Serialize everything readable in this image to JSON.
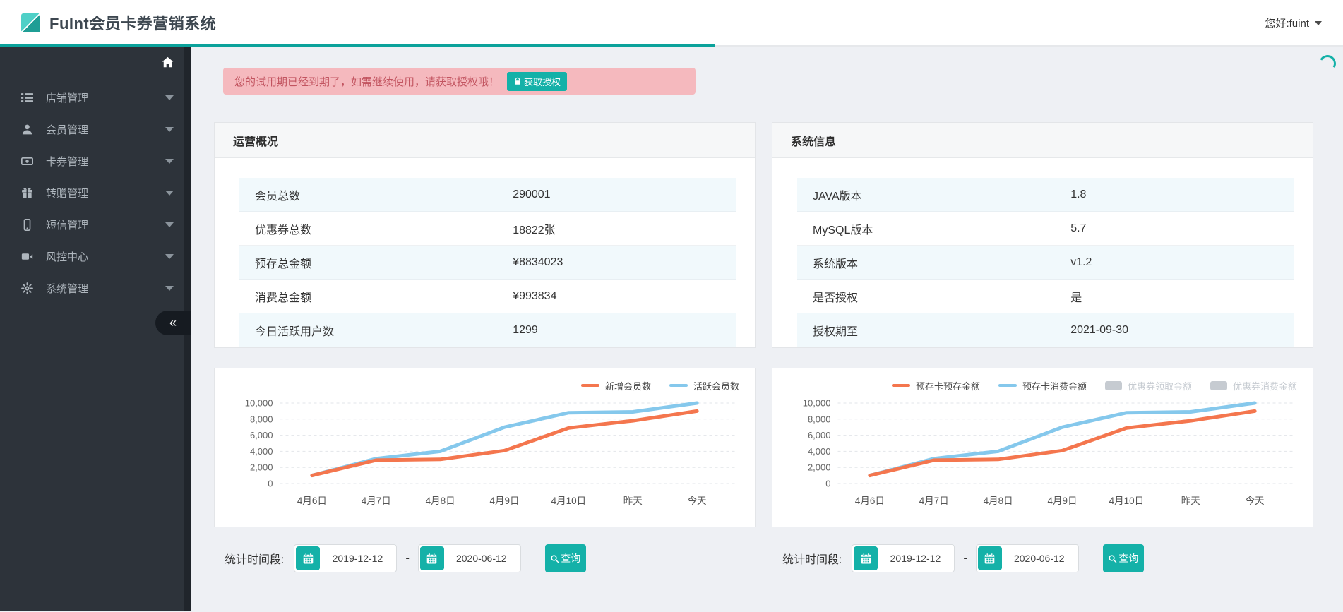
{
  "header": {
    "logo_title": "FuInt会员卡券营销系统",
    "user_greeting": "您好:fuint"
  },
  "sidebar": {
    "collapse_glyph": "«",
    "items": [
      {
        "label": "店铺管理",
        "icon": "list-icon"
      },
      {
        "label": "会员管理",
        "icon": "user-icon"
      },
      {
        "label": "卡券管理",
        "icon": "money-icon"
      },
      {
        "label": "转赠管理",
        "icon": "gift-icon"
      },
      {
        "label": "短信管理",
        "icon": "mobile-icon"
      },
      {
        "label": "风控中心",
        "icon": "video-icon"
      },
      {
        "label": "系统管理",
        "icon": "gear-icon"
      }
    ]
  },
  "alert": {
    "text": "您的试用期已经到期了，如需继续使用，请获取授权哦！",
    "button_label": "获取授权",
    "button_icon": "lock-icon"
  },
  "overview_card": {
    "title": "运营概况",
    "rows": [
      {
        "label": "会员总数",
        "value": "290001"
      },
      {
        "label": "优惠券总数",
        "value": "18822张"
      },
      {
        "label": "预存总金额",
        "value": "¥8834023"
      },
      {
        "label": "消费总金额",
        "value": "¥993834"
      },
      {
        "label": "今日活跃用户数",
        "value": "1299"
      }
    ]
  },
  "system_card": {
    "title": "系统信息",
    "rows": [
      {
        "label": "JAVA版本",
        "value": "1.8"
      },
      {
        "label": "MySQL版本",
        "value": "5.7"
      },
      {
        "label": "系统版本",
        "value": "v1.2"
      },
      {
        "label": "是否授权",
        "value": "是"
      },
      {
        "label": "授权期至",
        "value": "2021-09-30"
      }
    ]
  },
  "chart_data": [
    {
      "type": "line",
      "title": "",
      "categories": [
        "4月6日",
        "4月7日",
        "4月8日",
        "4月9日",
        "4月10日",
        "昨天",
        "今天"
      ],
      "series": [
        {
          "name": "新增会员数",
          "color": "#f4764e",
          "swatch": "line",
          "disabled": false,
          "values": [
            1000,
            2900,
            3000,
            4100,
            6900,
            7800,
            9000
          ]
        },
        {
          "name": "活跃会员数",
          "color": "#85c8ec",
          "swatch": "line",
          "disabled": false,
          "values": [
            1000,
            3100,
            4000,
            7000,
            8800,
            8900,
            10000
          ]
        }
      ],
      "ylim": [
        0,
        10000
      ],
      "yticks": [
        "10,000",
        "8,000",
        "6,000",
        "4,000",
        "2,000",
        "0"
      ],
      "grid": "dashed-horizontal",
      "legend_position": "top-right"
    },
    {
      "type": "line",
      "title": "",
      "categories": [
        "4月6日",
        "4月7日",
        "4月8日",
        "4月9日",
        "4月10日",
        "昨天",
        "今天"
      ],
      "series": [
        {
          "name": "预存卡预存金额",
          "color": "#f4764e",
          "swatch": "line",
          "disabled": false,
          "values": [
            1000,
            2900,
            3000,
            4100,
            6900,
            7800,
            9000
          ]
        },
        {
          "name": "预存卡消费金额",
          "color": "#85c8ec",
          "swatch": "line",
          "disabled": false,
          "values": [
            1000,
            3100,
            4000,
            7000,
            8800,
            8900,
            10000
          ]
        },
        {
          "name": "优惠券领取金额",
          "color": "#c6cbd1",
          "swatch": "rect",
          "disabled": true,
          "values": []
        },
        {
          "name": "优惠券消费金额",
          "color": "#c6cbd1",
          "swatch": "rect",
          "disabled": true,
          "values": []
        }
      ],
      "ylim": [
        0,
        10000
      ],
      "yticks": [
        "10,000",
        "8,000",
        "6,000",
        "4,000",
        "2,000",
        "0"
      ],
      "grid": "dashed-horizontal",
      "legend_position": "top-right"
    }
  ],
  "filters": {
    "label": "统计时间段:",
    "start_date": "2019-12-12",
    "separator": "-",
    "end_date": "2020-06-12",
    "search_label": "查询"
  },
  "colors": {
    "accent_teal": "#14b1a8",
    "header_underline": "#0ba29b",
    "sidebar_bg": "#2d333a",
    "alert_bg": "#f5b9be",
    "alert_text": "#c25460",
    "series_orange": "#f4764e",
    "series_blue": "#85c8ec",
    "legend_disabled": "#c6cbd1",
    "row_stripe": "#f1f9fc"
  }
}
